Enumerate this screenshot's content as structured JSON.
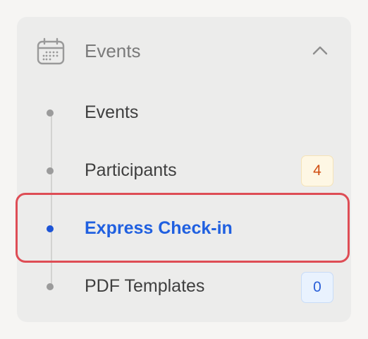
{
  "nav_group": {
    "label": "Events",
    "icon": "calendar-icon",
    "expanded": true,
    "toggle_icon": "chevron-up-icon"
  },
  "items": [
    {
      "label": "Events",
      "badge": null,
      "active": false
    },
    {
      "label": "Participants",
      "badge": "4",
      "badge_tone": "warning",
      "active": false
    },
    {
      "label": "Express Check-in",
      "badge": null,
      "active": true
    },
    {
      "label": "PDF Templates",
      "badge": "0",
      "badge_tone": "info",
      "active": false
    }
  ],
  "colors": {
    "accent": "#2060e0",
    "highlight_outline": "#de4d55",
    "badge_warning_text": "#d04e12",
    "badge_info_text": "#2a5fd8"
  }
}
